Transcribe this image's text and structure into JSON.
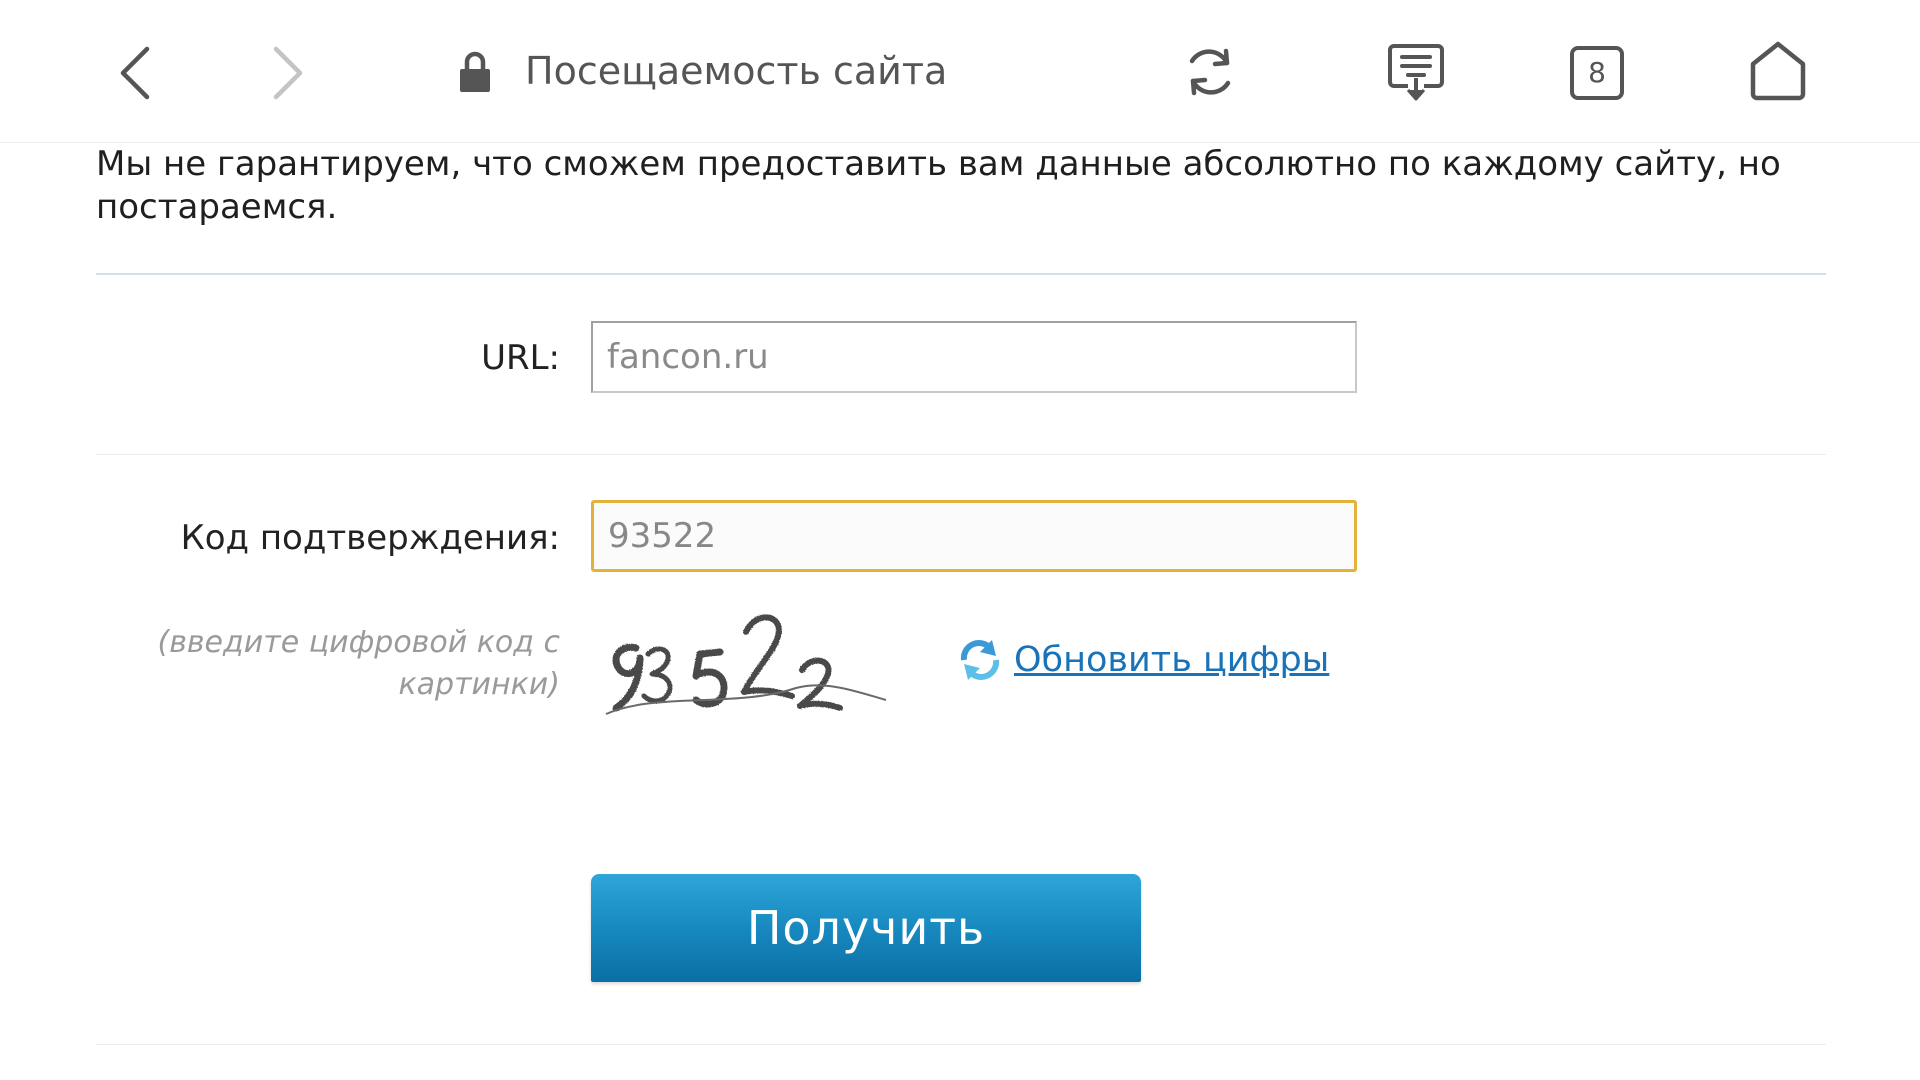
{
  "browser": {
    "page_title": "Посещаемость сайта",
    "tab_count": "8",
    "icons": {
      "back": "chevron-left-icon",
      "forward": "chevron-right-icon",
      "secure": "lock-icon",
      "reload": "reload-icon",
      "reader": "reader-mode-icon",
      "tabs": "tabs-icon",
      "home": "home-icon"
    }
  },
  "page": {
    "intro_text": "Мы не гарантируем, что сможем предоставить вам данные абсолютно по каждому сайту, но постараемся.",
    "url_label": "URL:",
    "url_value": "fancon.ru",
    "code_label": "Код подтверждения:",
    "code_value": "93522",
    "code_hint": "(введите цифровой код с картинки)",
    "captcha_digits": "93522",
    "refresh_label": "Обновить цифры",
    "submit_label": "Получить",
    "colors": {
      "link": "#1a73b8",
      "button": "#1789c0",
      "focus_border": "#e2b23a"
    }
  }
}
